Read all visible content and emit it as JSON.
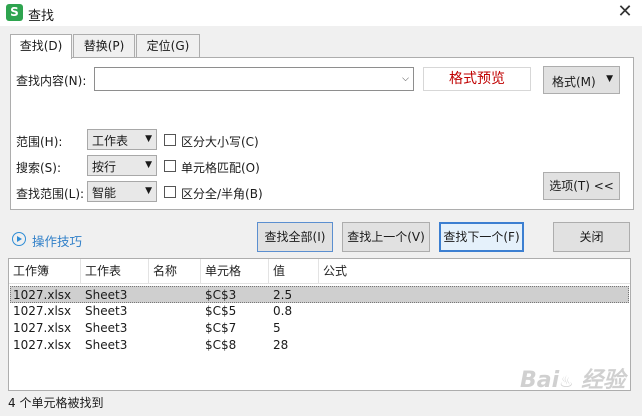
{
  "window": {
    "icon_letter": "S",
    "title": "查找",
    "close_glyph": "✕"
  },
  "tabs": [
    {
      "label": "查找(D)",
      "active": true
    },
    {
      "label": "替换(P)",
      "active": false
    },
    {
      "label": "定位(G)",
      "active": false
    }
  ],
  "find": {
    "content_label": "查找内容(N):",
    "content_value": "",
    "format_preview": "格式预览",
    "format_button": "格式(M)"
  },
  "options": {
    "scope_label": "范围(H):",
    "scope_value": "工作表",
    "search_label": "搜索(S):",
    "search_value": "按行",
    "range_label": "查找范围(L):",
    "range_value": "智能",
    "match_case": "区分大小写(C)",
    "match_cell": "单元格匹配(O)",
    "match_width": "区分全/半角(B)",
    "options_button": "选项(T) <<"
  },
  "actions": {
    "tips": "操作技巧",
    "find_all": "查找全部(I)",
    "find_prev": "查找上一个(V)",
    "find_next": "查找下一个(F)",
    "close": "关闭"
  },
  "results": {
    "columns": [
      "工作簿",
      "工作表",
      "名称",
      "单元格",
      "值",
      "公式"
    ],
    "rows": [
      [
        "1027.xlsx",
        "Sheet3",
        "",
        "$C$3",
        "2.5",
        ""
      ],
      [
        "1027.xlsx",
        "Sheet3",
        "",
        "$C$5",
        "0.8",
        ""
      ],
      [
        "1027.xlsx",
        "Sheet3",
        "",
        "$C$7",
        "5",
        ""
      ],
      [
        "1027.xlsx",
        "Sheet3",
        "",
        "$C$8",
        "28",
        ""
      ]
    ],
    "selected_row": 0
  },
  "status": "4 个单元格被找到",
  "watermark": "Baidu 经验"
}
